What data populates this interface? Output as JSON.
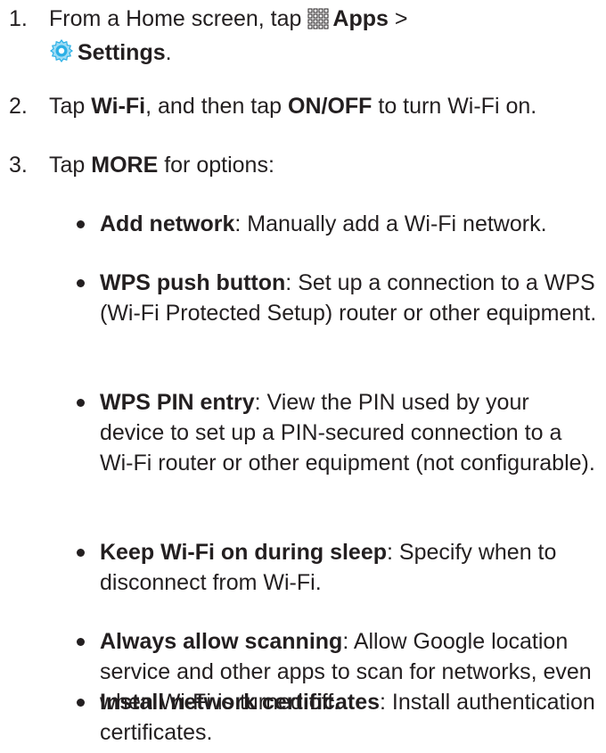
{
  "steps": [
    {
      "num": "1.",
      "prefix": "From a Home screen, tap ",
      "icon1": "apps-grid-icon",
      "bold1": "Apps",
      "sep": " >",
      "icon2": "settings-gear-icon",
      "bold2": "Settings",
      "suffix": "."
    },
    {
      "num": "2.",
      "t1": "Tap ",
      "b1": "Wi-Fi",
      "t2": ", and then tap ",
      "b2": "ON/OFF",
      "t3": " to turn Wi-Fi on."
    },
    {
      "num": "3.",
      "t1": "Tap ",
      "b1": "MORE",
      "t2": " for options:"
    }
  ],
  "options": [
    {
      "label": "Add network",
      "desc": ": Manually add a Wi-Fi network."
    },
    {
      "label": "WPS push button",
      "desc": ": Set up a connection to a WPS (Wi-Fi Protected Setup) router or other equipment."
    },
    {
      "label": "WPS PIN entry",
      "desc": ": View the PIN used by your device to set up a PIN-secured connection to a Wi-Fi router or other equipment (not configurable)."
    },
    {
      "label": "Keep Wi-Fi on during sleep",
      "desc": ": Specify when to disconnect from Wi-Fi."
    },
    {
      "label": "Always allow scanning",
      "desc": ": Allow Google location service and other apps to scan for networks, even when Wi-Fi is turned off."
    },
    {
      "label": "Install network certificates",
      "desc": ": Install authentication certificates."
    }
  ],
  "colors": {
    "text": "#231f20",
    "settings_icon": "#2bb0e6"
  }
}
